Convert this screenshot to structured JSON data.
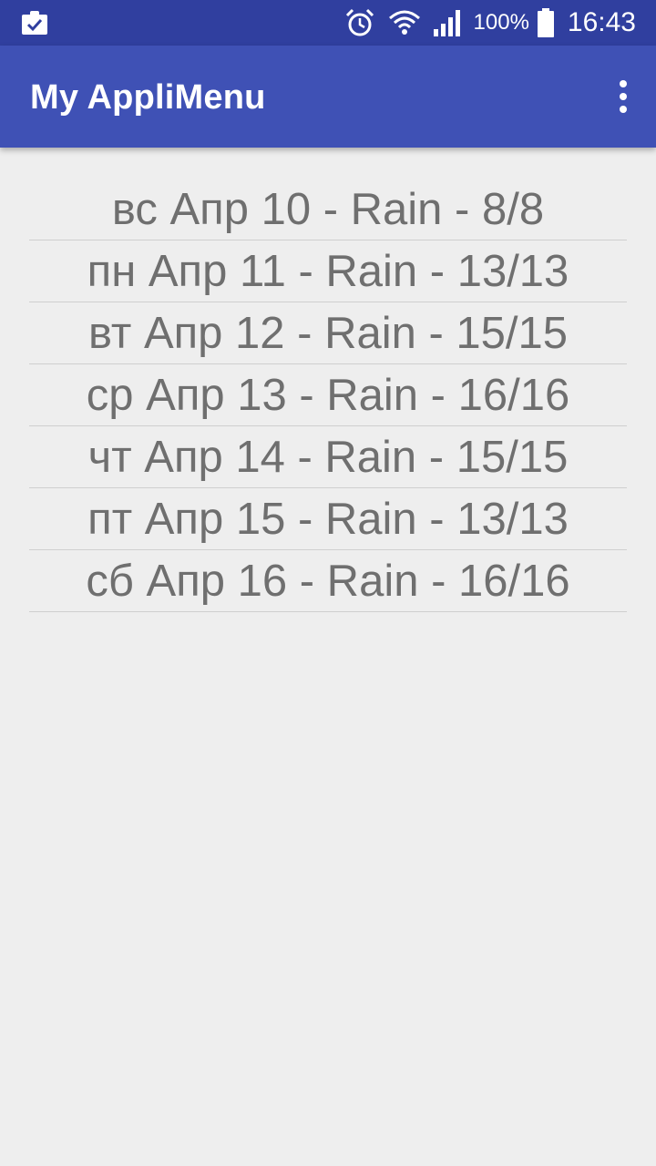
{
  "status_bar": {
    "left_icon": "clipboard-check-icon",
    "icons": [
      "alarm-clock-icon",
      "wifi-icon",
      "cellular-signal-icon",
      "battery-icon"
    ],
    "battery_percent": "100%",
    "time": "16:43"
  },
  "app_bar": {
    "title": "My AppliMenu",
    "overflow_icon": "more-vert-icon"
  },
  "forecast": [
    {
      "text": "вс Апр 10 - Rain - 8/8"
    },
    {
      "text": "пн Апр 11 - Rain - 13/13"
    },
    {
      "text": "вт Апр 12 - Rain - 15/15"
    },
    {
      "text": "ср Апр 13 - Rain - 16/16"
    },
    {
      "text": "чт Апр 14 - Rain - 15/15"
    },
    {
      "text": "пт Апр 15 - Rain - 13/13"
    },
    {
      "text": "сб Апр 16 - Rain - 16/16"
    }
  ],
  "colors": {
    "status_bar": "#303f9f",
    "app_bar": "#3f51b5",
    "background": "#eeeeee",
    "list_text": "#6f6f6f"
  }
}
